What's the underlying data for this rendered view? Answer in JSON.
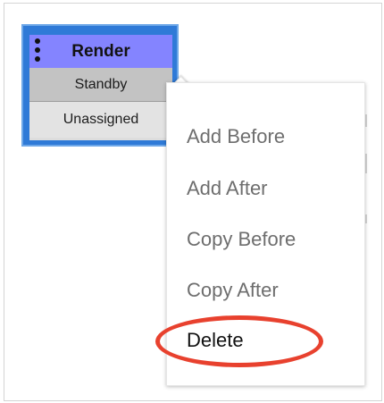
{
  "node": {
    "title": "Render",
    "status": "Standby",
    "assignment": "Unassigned"
  },
  "context_menu": {
    "items": [
      {
        "label": "Add Before"
      },
      {
        "label": "Add After"
      },
      {
        "label": "Copy Before"
      },
      {
        "label": "Copy After"
      },
      {
        "label": "Delete"
      }
    ]
  },
  "colors": {
    "node_border": "#2f7ad7",
    "node_header": "#8484ff",
    "highlight": "#e8412e",
    "menu_text": "#6e6e6e"
  },
  "icons": {
    "node_menu": "kebab-icon"
  }
}
